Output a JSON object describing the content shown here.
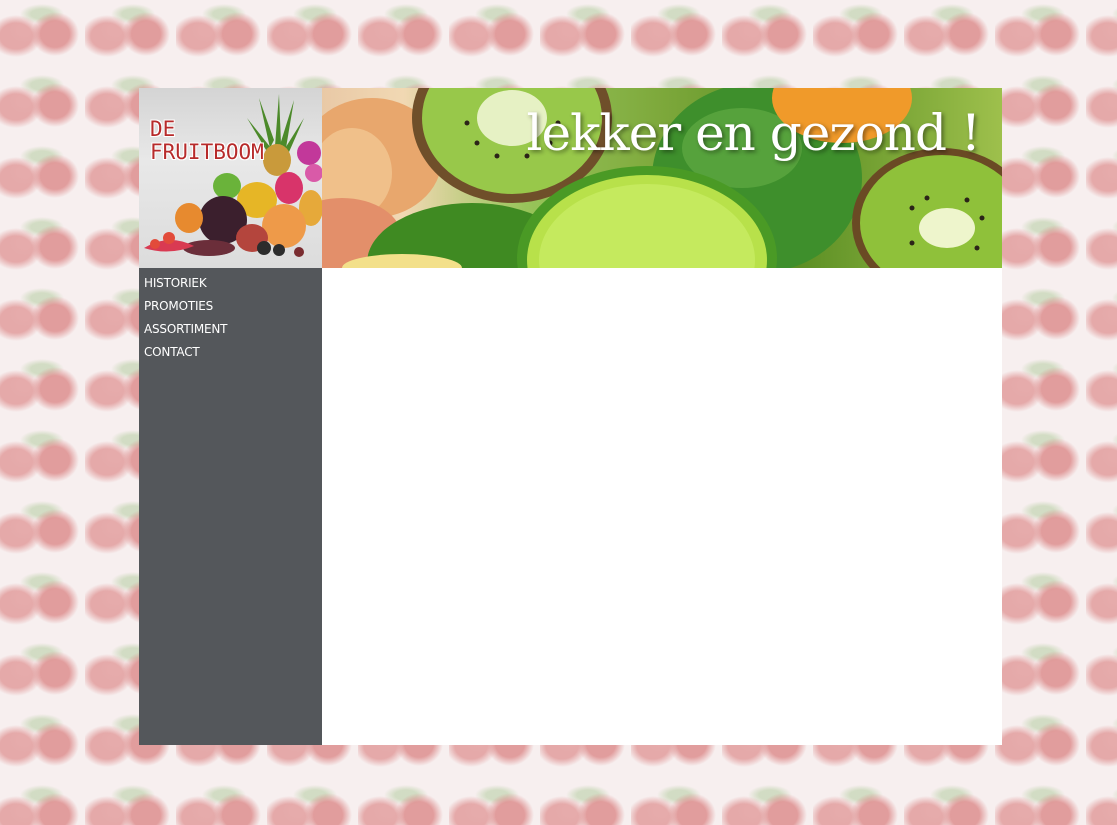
{
  "site": {
    "logo_line1": "DE",
    "logo_line2": "FRUITBOOM",
    "slogan": "lekker en gezond !"
  },
  "nav": {
    "items": [
      {
        "label": "HISTORIEK"
      },
      {
        "label": "PROMOTIES"
      },
      {
        "label": "ASSORTIMENT"
      },
      {
        "label": "CONTACT"
      }
    ]
  },
  "colors": {
    "sidebar": "#54575b",
    "logo_text": "#b72a2a",
    "wallpaper_fruit": "strawberry",
    "banner_fruit": "kiwi-lime"
  }
}
